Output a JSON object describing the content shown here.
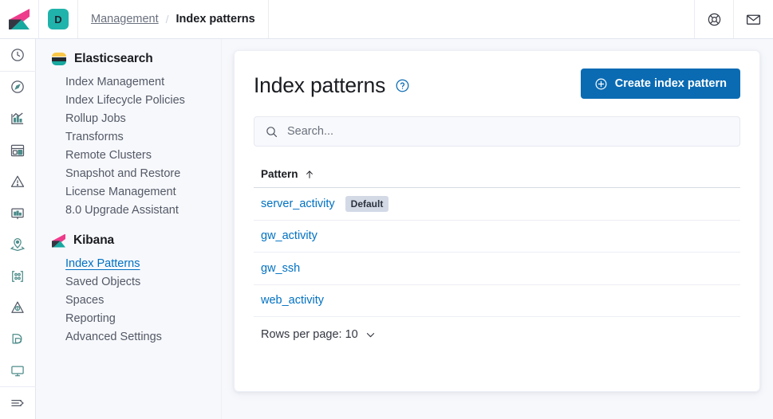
{
  "header": {
    "logo_icon": "kibana-logo",
    "avatar_initial": "D",
    "breadcrumbs": [
      {
        "label": "Management",
        "active": false
      },
      {
        "label": "Index patterns",
        "active": true
      }
    ],
    "separator": "/",
    "help_icon": "help-life-ring-icon",
    "mail_icon": "mail-envelope-icon"
  },
  "rail": {
    "items": [
      {
        "icon": "recently-viewed-clock-icon"
      },
      {
        "icon": "discover-compass-icon"
      },
      {
        "icon": "visualize-chart-icon"
      },
      {
        "icon": "dashboard-icon"
      },
      {
        "icon": "alerts-warning-icon"
      },
      {
        "icon": "canvas-icon"
      },
      {
        "icon": "maps-location-icon"
      },
      {
        "icon": "graph-nodes-icon"
      },
      {
        "icon": "machine-learning-icon"
      },
      {
        "icon": "logs-stack-icon"
      },
      {
        "icon": "uptime-monitor-icon"
      }
    ],
    "collapse_icon": "collapse-arrow-icon"
  },
  "sidebar": {
    "groups": [
      {
        "title": "Elasticsearch",
        "logo": "elasticsearch-logo",
        "items": [
          {
            "label": "Index Management",
            "selected": false
          },
          {
            "label": "Index Lifecycle Policies",
            "selected": false
          },
          {
            "label": "Rollup Jobs",
            "selected": false
          },
          {
            "label": "Transforms",
            "selected": false
          },
          {
            "label": "Remote Clusters",
            "selected": false
          },
          {
            "label": "Snapshot and Restore",
            "selected": false
          },
          {
            "label": "License Management",
            "selected": false
          },
          {
            "label": "8.0 Upgrade Assistant",
            "selected": false
          }
        ]
      },
      {
        "title": "Kibana",
        "logo": "kibana-logo",
        "items": [
          {
            "label": "Index Patterns",
            "selected": true
          },
          {
            "label": "Saved Objects",
            "selected": false
          },
          {
            "label": "Spaces",
            "selected": false
          },
          {
            "label": "Reporting",
            "selected": false
          },
          {
            "label": "Advanced Settings",
            "selected": false
          }
        ]
      }
    ]
  },
  "main": {
    "title": "Index patterns",
    "help_icon": "question-circle-icon",
    "create_button": {
      "label": "Create index pattern",
      "icon": "plus-circle-icon",
      "color": "#0a6bb3"
    },
    "search": {
      "placeholder": "Search...",
      "value": "",
      "icon": "search-icon"
    },
    "table": {
      "column_header": "Pattern",
      "sort_icon": "sort-ascending-arrow-icon",
      "sort_direction": "asc",
      "rows": [
        {
          "pattern": "server_activity",
          "badge": "Default"
        },
        {
          "pattern": "gw_activity",
          "badge": ""
        },
        {
          "pattern": "gw_ssh",
          "badge": ""
        },
        {
          "pattern": "web_activity",
          "badge": ""
        }
      ]
    },
    "pagination": {
      "label": "Rows per page: 10",
      "chevron_icon": "chevron-down-icon"
    }
  },
  "colors": {
    "link": "#0071c2",
    "primary": "#0a6bb3",
    "badge_bg": "#d3dae6",
    "page_bg": "#f7f8fc"
  }
}
